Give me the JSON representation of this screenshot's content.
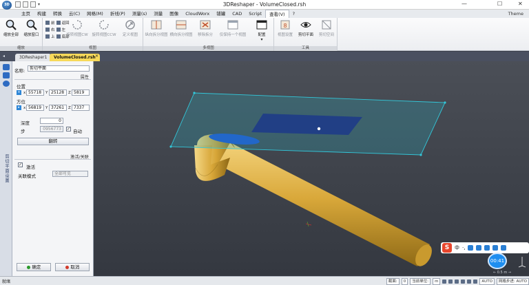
{
  "window": {
    "title": "3DReshaper - VolumeClosed.rsh",
    "logo": "3D",
    "dropdown_arrow": "▾",
    "min_glyph": "—",
    "max_glyph": "☐",
    "close_glyph": "✕"
  },
  "menu": {
    "items": [
      "主页",
      "构建",
      "转换",
      "云(C)",
      "网格(M)",
      "折线(P)",
      "测量(s)",
      "测量",
      "图像",
      "CloudWorx",
      "铺罐",
      "CAD",
      "Script",
      "查看(V)",
      "?"
    ],
    "active_index": 13,
    "theme_label": "Theme"
  },
  "ribbon": {
    "groups": [
      {
        "label": "缩放"
      },
      {
        "label": "视图"
      },
      {
        "label": "多视图"
      },
      {
        "label": "工具"
      }
    ],
    "zoom_all": "缩放全部",
    "zoom_window": "缩放窗口",
    "small_buttons": [
      {
        "label": "前",
        "label2": "返回"
      },
      {
        "label": "右",
        "label2": "左"
      },
      {
        "label": "上",
        "label2": "底部"
      }
    ],
    "view_buttons": [
      "旋转视图CW",
      "旋转视图CCW",
      "定义视图"
    ],
    "multi_buttons": [
      "纵向拆分视图",
      "横向拆分视图",
      "移除拆分",
      "仅保持一个视图",
      "配置"
    ],
    "tool_buttons": [
      "视图设置",
      "剪切平面",
      "剪切空间"
    ],
    "config_arrow": "▾"
  },
  "tabs": [
    {
      "label": "3DReshaper1"
    },
    {
      "label": "VolumeClosed.rsh"
    }
  ],
  "panel": {
    "vertical_title": "剪切平面设置",
    "name_label": "名称:",
    "name_value": "剪切平面",
    "attributes_title": "属性",
    "position_label": "位置",
    "position": {
      "x": "55718",
      "y": "25128",
      "z": "5819"
    },
    "orientation_label": "方位",
    "orientation": {
      "x": "56819",
      "y": "37261",
      "z": "7337"
    },
    "x_prefix": "x",
    "y_prefix": "Y",
    "z_prefix": "Z",
    "depth_label": "深度",
    "depth_value": "0",
    "step_label": "步",
    "step_value": "0956773",
    "auto_label": "自动",
    "flip_button": "翻转",
    "activate_section": "激活/关联",
    "activate_label": "激活",
    "link_mode_label": "关联模式",
    "link_mode_value": "全部可见",
    "ok_button": "确定",
    "cancel_button": "取消"
  },
  "status": {
    "left_text": "就绪",
    "section_label": "截面:",
    "section_value": "0",
    "unit_label": "当前单位:",
    "unit_value": "m",
    "auto_value": "AUTO",
    "grid_step": "网格步进: AUTO"
  },
  "overlay": {
    "ime_char": "S",
    "ime_lang": "中",
    "ime_punct": "·,",
    "timer": "00:41",
    "scale": "← 0.5 m →"
  },
  "colors": {
    "accent_tab": "#f7d95a",
    "pipe": "#e3b54a",
    "plane_outline": "#33c7d9",
    "plane_inner": "#1c3a8a"
  }
}
